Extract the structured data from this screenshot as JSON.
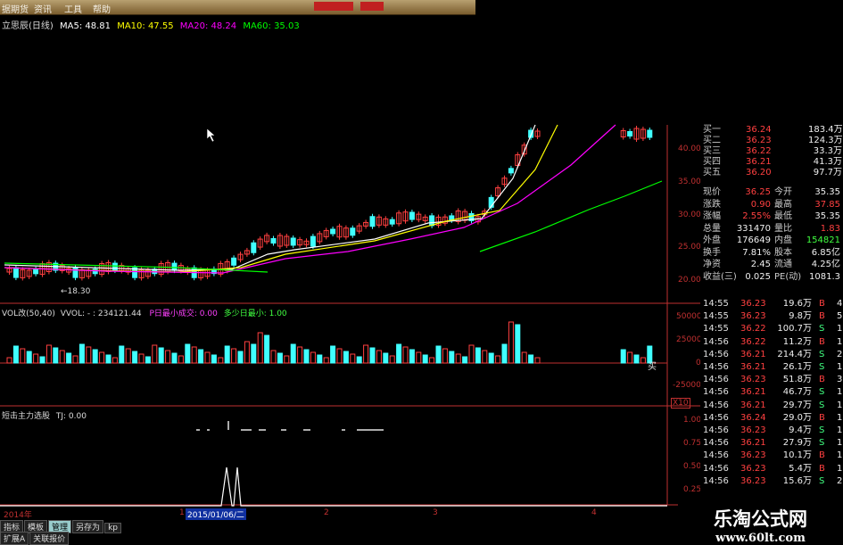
{
  "menubar": {
    "items": [
      "据期货",
      "资讯",
      "工具",
      "帮助"
    ],
    "alerts": [
      "                ",
      "        "
    ]
  },
  "stock": {
    "title": "立思辰(日线)",
    "ma": [
      {
        "label": "MA5: 48.81",
        "color": "#ffffff"
      },
      {
        "label": "MA10: 47.55",
        "color": "#ffff00"
      },
      {
        "label": "MA20: 48.24",
        "color": "#ff00ff"
      },
      {
        "label": "MA60: 35.03",
        "color": "#00ff00"
      }
    ]
  },
  "price_axis": [
    "40.00",
    "35.00",
    "30.00",
    "25.00",
    "20.00"
  ],
  "low_label": "←18.30",
  "vol_indicator": {
    "title": "VOL改(50,40)",
    "vvol": "VVOL: - : 234121.44",
    "p": "P日最小成交: 0.00",
    "d": "多少日最小: 1.00",
    "axis": [
      "50000",
      "25000",
      "0",
      "-25000"
    ],
    "mark": "买"
  },
  "lower_indicator": {
    "title": "短击主力选股",
    "tj": "TJ: 0.00",
    "scale": "X10",
    "axis": [
      "1.00",
      "0.75",
      "0.50",
      "0.25"
    ]
  },
  "timeline": {
    "year": "2014年",
    "date": "2015/01/06/二",
    "months": [
      "1",
      "2",
      "3",
      "4"
    ]
  },
  "bottom_tabs": [
    "指标",
    "模板",
    "管理",
    "另存为",
    "kp"
  ],
  "bottom_tabs2": [
    "扩展A",
    "关联报价"
  ],
  "quote": {
    "bids": [
      {
        "label": "买一",
        "price": "36.24",
        "vol": "183.4万"
      },
      {
        "label": "买二",
        "price": "36.23",
        "vol": "124.3万"
      },
      {
        "label": "买三",
        "price": "36.22",
        "vol": "33.3万"
      },
      {
        "label": "买四",
        "price": "36.21",
        "vol": "41.3万"
      },
      {
        "label": "买五",
        "price": "36.20",
        "vol": "97.7万"
      }
    ],
    "stats": [
      {
        "l1": "现价",
        "v1": "36.25",
        "l2": "今开",
        "v2": "35.35"
      },
      {
        "l1": "涨跌",
        "v1": "0.90",
        "l2": "最高",
        "v2": "37.85"
      },
      {
        "l1": "涨幅",
        "v1": "2.55%",
        "l2": "最低",
        "v2": "35.35"
      },
      {
        "l1": "总量",
        "v1": "331470",
        "l2": "量比",
        "v2": "1.83"
      },
      {
        "l1": "外盘",
        "v1": "176649",
        "l2": "内盘",
        "v2": "154821"
      },
      {
        "l1": "换手",
        "v1": "7.81%",
        "l2": "股本",
        "v2": "6.85亿"
      },
      {
        "l1": "净资",
        "v1": "2.45",
        "l2": "流通",
        "v2": "4.25亿"
      },
      {
        "l1": "收益(三)",
        "v1": "0.025",
        "l2": "PE(动)",
        "v2": "1081.3"
      }
    ]
  },
  "ticks": [
    {
      "t": "14:55",
      "p": "36.23",
      "v": "19.6万",
      "bs": "B",
      "n": "4"
    },
    {
      "t": "14:55",
      "p": "36.23",
      "v": "9.8万",
      "bs": "B",
      "n": "5"
    },
    {
      "t": "14:55",
      "p": "36.22",
      "v": "100.7万",
      "bs": "S",
      "n": "1"
    },
    {
      "t": "14:56",
      "p": "36.22",
      "v": "11.2万",
      "bs": "B",
      "n": "1"
    },
    {
      "t": "14:56",
      "p": "36.21",
      "v": "214.4万",
      "bs": "S",
      "n": "2"
    },
    {
      "t": "14:56",
      "p": "36.21",
      "v": "26.1万",
      "bs": "S",
      "n": "1"
    },
    {
      "t": "14:56",
      "p": "36.23",
      "v": "51.8万",
      "bs": "B",
      "n": "3"
    },
    {
      "t": "14:56",
      "p": "36.21",
      "v": "46.7万",
      "bs": "S",
      "n": "1"
    },
    {
      "t": "14:56",
      "p": "36.21",
      "v": "29.7万",
      "bs": "S",
      "n": "1"
    },
    {
      "t": "14:56",
      "p": "36.24",
      "v": "29.0万",
      "bs": "B",
      "n": "1"
    },
    {
      "t": "14:56",
      "p": "36.23",
      "v": "9.4万",
      "bs": "S",
      "n": "1"
    },
    {
      "t": "14:56",
      "p": "36.21",
      "v": "27.9万",
      "bs": "S",
      "n": "1"
    },
    {
      "t": "14:56",
      "p": "36.23",
      "v": "10.1万",
      "bs": "B",
      "n": "1"
    },
    {
      "t": "14:56",
      "p": "36.23",
      "v": "5.4万",
      "bs": "B",
      "n": "1"
    },
    {
      "t": "14:56",
      "p": "36.23",
      "v": "15.6万",
      "bs": "S",
      "n": "2"
    }
  ],
  "watermark": {
    "title": "乐淘公式网",
    "url": "www.60lt.com"
  },
  "colors": {
    "up": "#ff4040",
    "down": "#40ffff",
    "axis": "#c03030",
    "buy": "#ff4040",
    "sell": "#40ff80"
  }
}
